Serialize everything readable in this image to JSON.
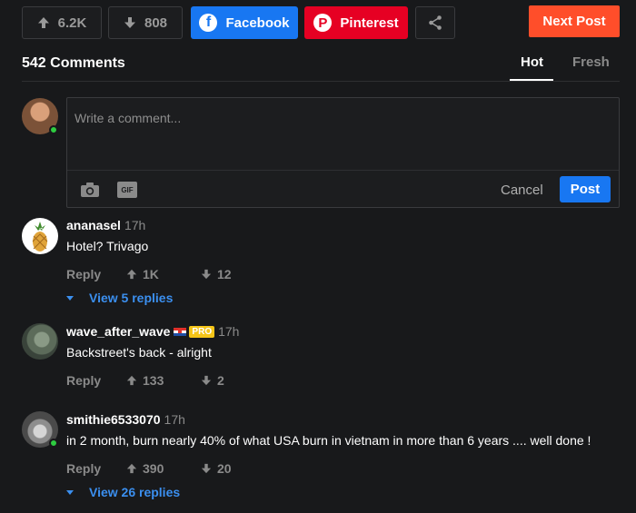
{
  "top_bar": {
    "upvote_count": "6.2K",
    "downvote_count": "808",
    "facebook_label": "Facebook",
    "pinterest_label": "Pinterest",
    "next_post_label": "Next Post"
  },
  "comments_header": {
    "count_label": "542 Comments",
    "tabs": [
      "Hot",
      "Fresh"
    ],
    "active_tab": "Hot"
  },
  "comment_box": {
    "placeholder": "Write a comment...",
    "gif_label": "GIF",
    "cancel_label": "Cancel",
    "post_label": "Post"
  },
  "comments": [
    {
      "username": "ananasel",
      "time": "17h",
      "text": "Hotel? Trivago",
      "reply_label": "Reply",
      "upvotes": "1K",
      "downvotes": "12",
      "view_replies": "View 5 replies"
    },
    {
      "username": "wave_after_wave",
      "badge": "PRO",
      "time": "17h",
      "text": "Backstreet's back - alright",
      "reply_label": "Reply",
      "upvotes": "133",
      "downvotes": "2"
    },
    {
      "username": "smithie6533070",
      "time": "17h",
      "text": "in 2 month, burn nearly 40% of what USA burn in vietnam in more than 6 years .... well done !",
      "reply_label": "Reply",
      "upvotes": "390",
      "downvotes": "20",
      "view_replies": "View 26 replies"
    }
  ],
  "colors": {
    "background": "#18191b",
    "facebook": "#1877f2",
    "pinterest": "#e60023",
    "next_post": "#ff4e2a",
    "link_blue": "#3b8fef",
    "pro_badge": "#f5c518",
    "online": "#2ecc40"
  }
}
